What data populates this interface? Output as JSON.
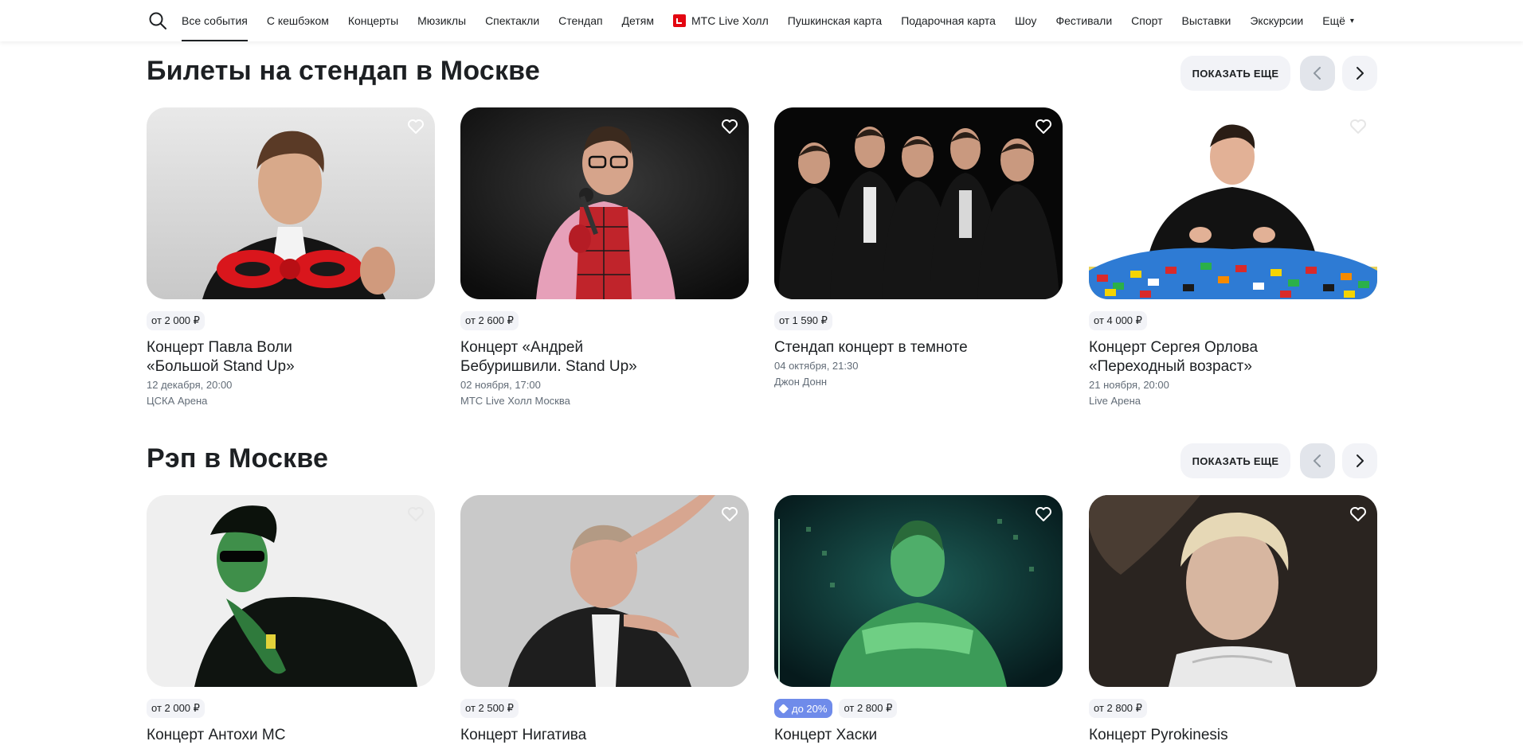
{
  "nav": {
    "search_icon": "search-icon",
    "items": [
      {
        "label": "Все события",
        "active": true
      },
      {
        "label": "С кешбэком"
      },
      {
        "label": "Концерты"
      },
      {
        "label": "Мюзиклы"
      },
      {
        "label": "Спектакли"
      },
      {
        "label": "Стендап"
      },
      {
        "label": "Детям"
      },
      {
        "label": "МТС Live Холл",
        "logo": true
      },
      {
        "label": "Пушкинская карта"
      },
      {
        "label": "Подарочная карта"
      },
      {
        "label": "Шоу"
      },
      {
        "label": "Фестивали"
      },
      {
        "label": "Спорт"
      },
      {
        "label": "Выставки"
      },
      {
        "label": "Экскурсии"
      },
      {
        "label": "Ещё",
        "caret": "▾"
      }
    ]
  },
  "sections": [
    {
      "title": "Билеты на стендап в Москве",
      "show_more": "ПОКАЗАТЬ ЕЩЕ",
      "cards": [
        {
          "price": "от 2 000 ₽",
          "title": "Концерт Павла Воли «Большой Stand Up»",
          "date": "12 декабря, 20:00",
          "venue": "ЦСКА Арена"
        },
        {
          "price": "от 2 600 ₽",
          "title": "Концерт «Андрей Бебуришвили. Stand Up»",
          "date": "02 ноября, 17:00",
          "venue": "МТС Live Холл Москва"
        },
        {
          "price": "от 1 590 ₽",
          "title": "Стендап концерт в темноте",
          "date": "04 октября, 21:30",
          "venue": "Джон Донн"
        },
        {
          "price": "от 4 000 ₽",
          "title": "Концерт Сергея Орлова «Переходный возраст»",
          "date": "21 ноября, 20:00",
          "venue": "Live Арена"
        }
      ]
    },
    {
      "title": "Рэп в Москве",
      "show_more": "ПОКАЗАТЬ ЕЩЕ",
      "cards": [
        {
          "price": "от 2 000 ₽",
          "title": "Концерт Антохи МС"
        },
        {
          "price": "от 2 500 ₽",
          "title": "Концерт Нигатива"
        },
        {
          "discount": "до 20%",
          "price": "от 2 800 ₽",
          "title": "Концерт Хаски"
        },
        {
          "price": "от 2 800 ₽",
          "title": "Концерт Pyrokinesis"
        }
      ]
    }
  ],
  "colors": {
    "text": "#1d2023",
    "secondary_text": "#626c77",
    "chip_bg": "#f2f3f7",
    "discount_bg": "#6f8bea",
    "mts_red": "#e30611"
  }
}
